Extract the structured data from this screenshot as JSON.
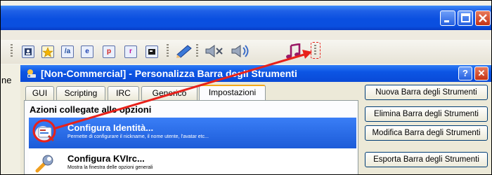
{
  "toolbar": {
    "icons": [
      "user-card-icon",
      "star-icon",
      "script-icon",
      "e-icon",
      "p-icon",
      "r-icon",
      "terminal-icon",
      "pen-icon",
      "speaker-mute-icon",
      "speaker-icon",
      "music-note-icon"
    ],
    "button_letters": {
      "script": "/a",
      "e": "e",
      "p": "p",
      "r": "r"
    }
  },
  "background": {
    "cut_text": "ne"
  },
  "dialog": {
    "title": "[Non-Commercial] - Personalizza Barra degli Strumenti",
    "help_label": "?",
    "close_label": "✕",
    "tabs": [
      {
        "label": "GUI",
        "active": false
      },
      {
        "label": "Scripting",
        "active": false
      },
      {
        "label": "IRC",
        "active": false
      },
      {
        "label": "Generico",
        "active": false
      },
      {
        "label": "Impostazioni",
        "active": true
      }
    ],
    "section_label": "Azioni collegate alle opzioni",
    "actions": [
      {
        "title": "Configura Identità...",
        "description": "Permette di configurare il nickname, il nome utente, l'avatar etc...",
        "selected": true,
        "icon": "identity-icon"
      },
      {
        "title": "Configura KVIrc...",
        "description": "Mostra la finestra delle opzioni generali",
        "selected": false,
        "icon": "wrench-icon"
      }
    ],
    "buttons": [
      "Nuova Barra degli Strumenti",
      "Elimina Barra degli Strumenti",
      "Modifica Barra degli Strumenti",
      "Esporta Barra degli Strumenti"
    ]
  },
  "colors": {
    "xp_blue": "#0a4fe0",
    "annotation_red": "#e8211a",
    "active_tab_accent": "#f4a81a",
    "selection": "#1c5bd8"
  }
}
